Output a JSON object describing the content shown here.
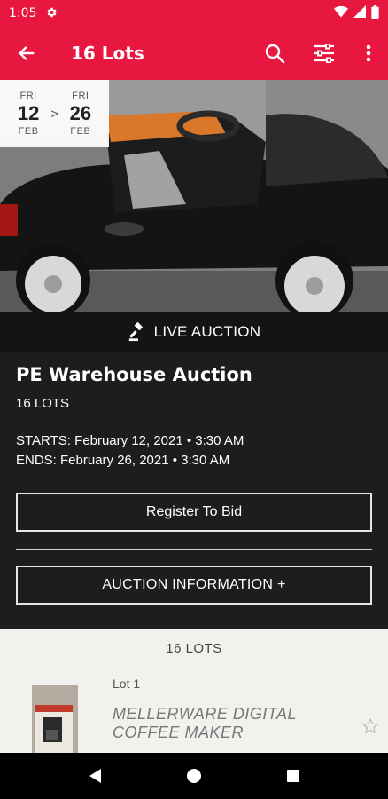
{
  "status_bar": {
    "time": "1:05",
    "icons": [
      "gear-icon",
      "wifi-icon",
      "signal-icon",
      "battery-icon"
    ]
  },
  "app_bar": {
    "title": "16 Lots",
    "color": "#e8173f",
    "icons": [
      "back-arrow-icon",
      "search-icon",
      "filter-sliders-icon",
      "more-vert-icon"
    ]
  },
  "hero": {
    "image_icon": "photo-of-black-toy-ride-on-car",
    "date_range": {
      "start": {
        "dow": "FRI",
        "day": "12",
        "month": "FEB"
      },
      "separator": ">",
      "end": {
        "dow": "FRI",
        "day": "26",
        "month": "FEB"
      }
    }
  },
  "banner": {
    "icon": "gavel-icon",
    "label": "LIVE AUCTION"
  },
  "auction": {
    "title": "PE Warehouse Auction",
    "lot_count": "16 LOTS",
    "starts": "STARTS: February 12, 2021 • 3:30 AM",
    "ends": "ENDS: February 26, 2021 • 3:30 AM",
    "register_label": "Register To Bid",
    "info_label": "AUCTION INFORMATION +"
  },
  "lots": {
    "header": "16 LOTS",
    "items": [
      {
        "number": "Lot 1",
        "name": "MELLERWARE DIGITAL COFFEE MAKER",
        "thumbnail_icon": "coffee-maker-box-photo",
        "favorite_icon": "star-outline-icon"
      }
    ]
  },
  "nav_bar": {
    "icons": [
      "nav-back-icon",
      "nav-home-icon",
      "nav-recents-icon"
    ]
  }
}
